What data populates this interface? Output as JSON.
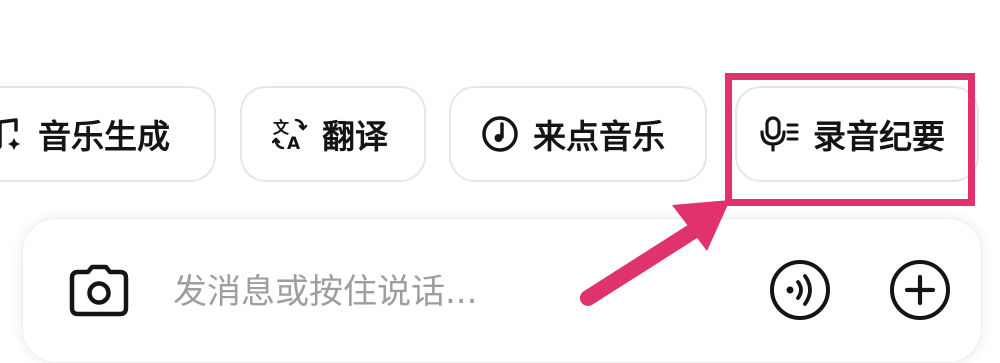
{
  "chips": [
    {
      "label": "音乐生成",
      "icon": "music-note-sparkle-icon"
    },
    {
      "label": "翻译",
      "icon": "translate-icon"
    },
    {
      "label": "来点音乐",
      "icon": "music-disc-icon"
    },
    {
      "label": "录音纪要",
      "icon": "microphone-notes-icon"
    }
  ],
  "input": {
    "placeholder": "发消息或按住说话...",
    "camera_icon": "camera-icon",
    "voice_icon": "voice-call-icon",
    "add_icon": "plus-circle-icon"
  },
  "annotation": {
    "color": "#e0326f"
  }
}
